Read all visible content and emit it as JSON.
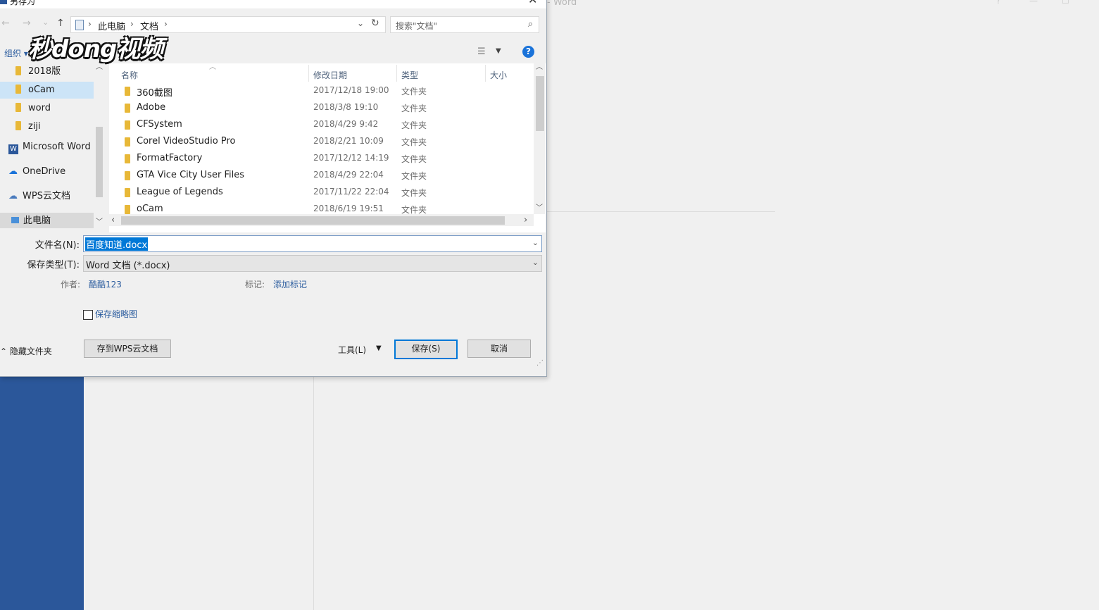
{
  "dialog": {
    "title": "另存为",
    "close": "✕"
  },
  "nav": {
    "back": "←",
    "forward": "→",
    "recent": "⌄",
    "up": "↑",
    "breadcrumb": [
      "此电脑",
      "文档"
    ],
    "search_placeholder": "搜索\"文档\""
  },
  "toolbar": {
    "organize": "组织 ▾",
    "logo_text": "秒dong视频",
    "help": "?"
  },
  "nav_pane": {
    "items": [
      {
        "label": "2018版",
        "icon": "folder-icon"
      },
      {
        "label": "oCam",
        "icon": "folder-icon",
        "selected": true
      },
      {
        "label": "word",
        "icon": "folder-icon"
      },
      {
        "label": "ziji",
        "icon": "folder-icon"
      },
      {
        "label": "Microsoft Word",
        "icon": "word-icon"
      },
      {
        "label": "OneDrive",
        "icon": "cloud-icon"
      },
      {
        "label": "WPS云文档",
        "icon": "wps-cloud-icon"
      },
      {
        "label": "此电脑",
        "icon": "computer-icon"
      }
    ]
  },
  "file_list": {
    "columns": [
      "名称",
      "修改日期",
      "类型",
      "大小"
    ],
    "rows": [
      {
        "name": "360截图",
        "date": "2017/12/18 19:00",
        "type": "文件夹"
      },
      {
        "name": "Adobe",
        "date": "2018/3/8 19:10",
        "type": "文件夹"
      },
      {
        "name": "CFSystem",
        "date": "2018/4/29 9:42",
        "type": "文件夹"
      },
      {
        "name": "Corel VideoStudio Pro",
        "date": "2018/2/21 10:09",
        "type": "文件夹"
      },
      {
        "name": "FormatFactory",
        "date": "2017/12/12 14:19",
        "type": "文件夹"
      },
      {
        "name": "GTA Vice City User Files",
        "date": "2018/4/29 22:04",
        "type": "文件夹"
      },
      {
        "name": "League of Legends",
        "date": "2017/11/22 22:04",
        "type": "文件夹"
      },
      {
        "name": "oCam",
        "date": "2018/6/19 19:51",
        "type": "文件夹"
      }
    ]
  },
  "form": {
    "filename_label": "文件名(N):",
    "filename_value": "百度知道.docx",
    "filetype_label": "保存类型(T):",
    "filetype_value": "Word 文档 (*.docx)",
    "author_label": "作者:",
    "author_value": "酷酷123",
    "tags_label": "标记:",
    "tags_value": "添加标记",
    "thumbnail_label": "保存缩略图"
  },
  "bottom": {
    "hide_folders": "隐藏文件夹",
    "save_wps": "存到WPS云文档",
    "tools": "工具(L)",
    "save": "保存(S)",
    "cancel": "取消"
  },
  "background": {
    "app_title": "- Word"
  },
  "colors": {
    "word_blue": "#2b579a",
    "accent": "#0078d7",
    "link": "#2b5c9e",
    "folder": "#e8b838"
  }
}
